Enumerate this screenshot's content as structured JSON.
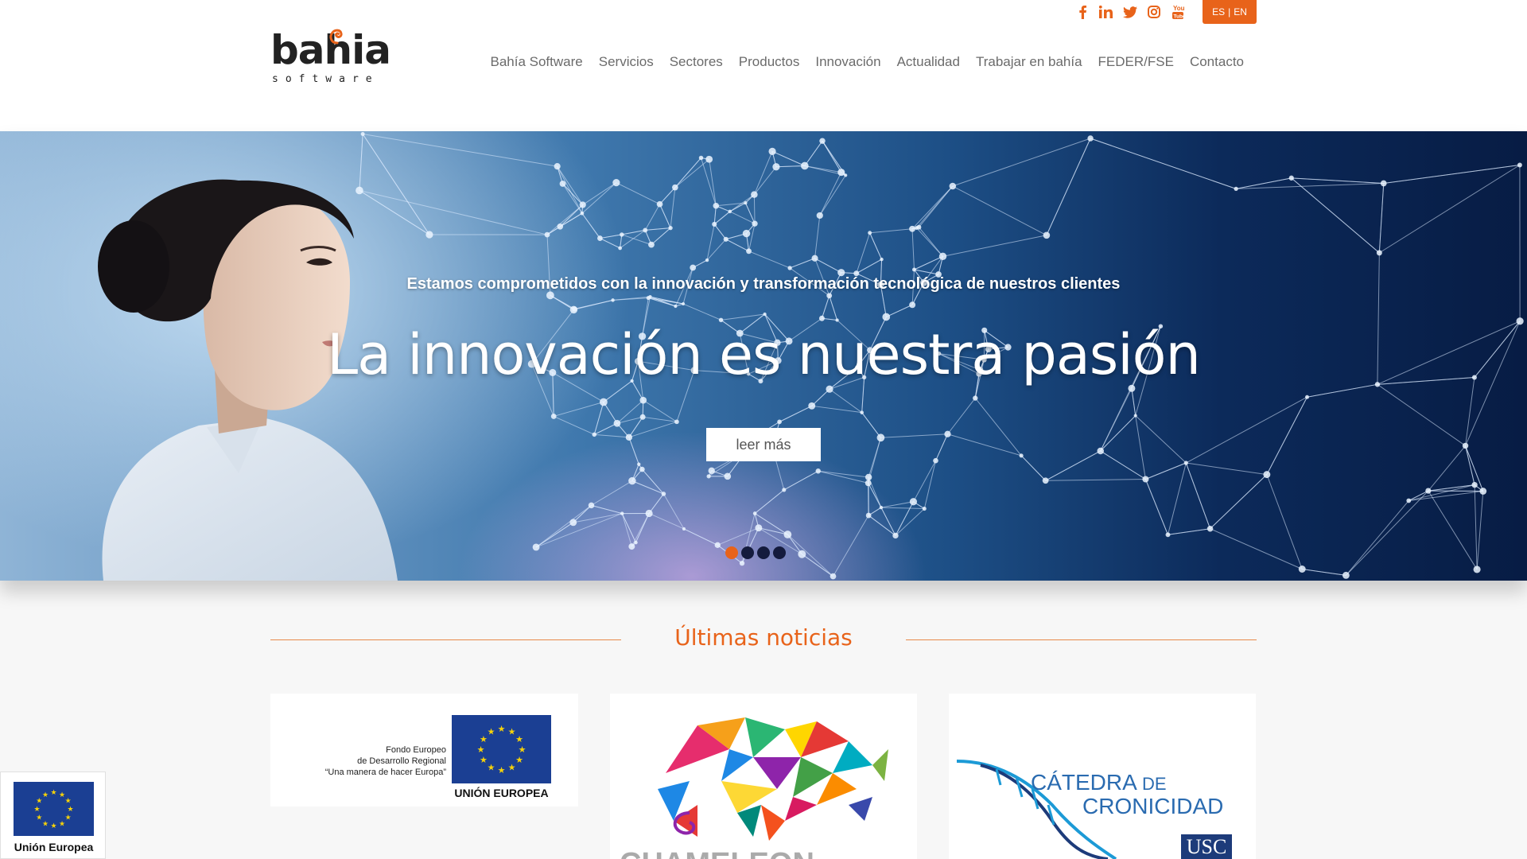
{
  "header": {
    "logo_text": "bahia",
    "logo_sub": "software",
    "language": {
      "es": "ES",
      "sep": "|",
      "en": "EN"
    },
    "social": [
      "facebook-icon",
      "linkedin-icon",
      "twitter-icon",
      "instagram-icon",
      "youtube-icon"
    ],
    "nav": [
      {
        "label": "Bahía Software"
      },
      {
        "label": "Servicios"
      },
      {
        "label": "Sectores"
      },
      {
        "label": "Productos"
      },
      {
        "label": "Innovación"
      },
      {
        "label": "Actualidad"
      },
      {
        "label": "Trabajar en bahía"
      },
      {
        "label": "FEDER/FSE"
      },
      {
        "label": "Contacto"
      }
    ]
  },
  "hero": {
    "subtitle": "Estamos comprometidos con la innovación y transformación tecnológica de nuestros clientes",
    "title": "La innovación es nuestra pasión",
    "button": "leer más",
    "slides": 4,
    "active_slide": 1
  },
  "news": {
    "title": "Últimas noticias",
    "cards": [
      {
        "feder_lines": [
          "Fondo Europeo",
          "de Desarrollo Regional",
          "“Una manera de hacer Europa”"
        ],
        "eu_label": "UNIÓN EUROPEA"
      },
      {
        "brand": "CHAMELEON"
      },
      {
        "line1_a": "CÁTEDRA",
        "line1_b": "DE",
        "line2": "CRONICIDAD",
        "badge": "USC"
      }
    ]
  },
  "eu_badge": {
    "label": "Unión Europea"
  },
  "colors": {
    "accent": "#e8631a",
    "eu_blue": "#1b3f93",
    "star": "#f6d20a"
  }
}
